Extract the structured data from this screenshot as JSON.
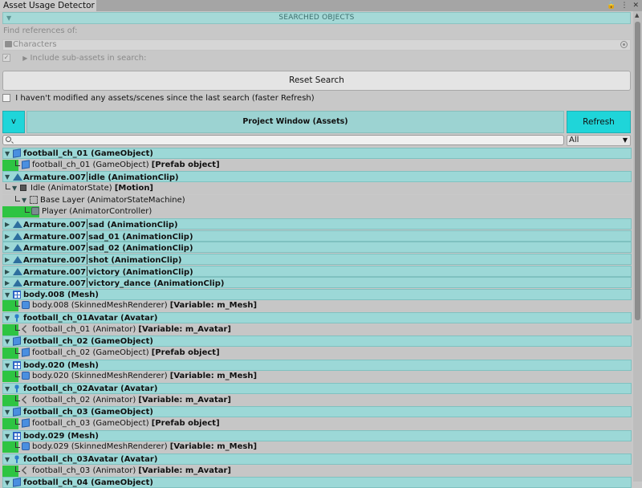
{
  "tab": {
    "title": "Asset Usage Detector"
  },
  "section": {
    "title": "SEARCHED OBJECTS"
  },
  "find": {
    "label": "Find references of:",
    "value": "Characters",
    "include_sub_assets_label": "Include sub-assets in search:"
  },
  "buttons": {
    "reset": "Reset Search",
    "refresh": "Refresh",
    "toggle": "v"
  },
  "faster_refresh_label": "I haven't modified any assets/scenes since the last search (faster Refresh)",
  "results": {
    "title": "Project Window (Assets)",
    "filter": "All",
    "search_placeholder": ""
  },
  "rows": [
    {
      "type": "top",
      "disclosure": "open",
      "icon": "gameobject-icon",
      "text": "football_ch_01 (GameObject)"
    },
    {
      "type": "child",
      "level": 1,
      "icon": "gameobject-icon",
      "text": "football_ch_01 (GameObject) ",
      "tag": "[Prefab object]",
      "bar": 20
    },
    {
      "type": "top",
      "disclosure": "open",
      "icon": "animation-clip-icon",
      "prefix": "Armature.007",
      "text": "idle (AnimationClip)"
    },
    {
      "type": "child",
      "level": 0,
      "disclosure": "open",
      "icon": "animator-state-icon",
      "text": "Idle (AnimatorState) ",
      "tag": "[Motion]",
      "bar": 0
    },
    {
      "type": "child",
      "level": 1,
      "disclosure": "open",
      "icon": "state-machine-icon",
      "text": "Base Layer (AnimatorStateMachine)",
      "tag": "",
      "bar": 0
    },
    {
      "type": "child",
      "level": 2,
      "icon": "animator-controller-icon",
      "text": "Player (AnimatorController)",
      "tag": "",
      "bar": 46
    },
    {
      "type": "top",
      "disclosure": "closed",
      "icon": "animation-clip-icon",
      "prefix": "Armature.007",
      "text": "sad (AnimationClip)"
    },
    {
      "type": "top",
      "disclosure": "closed",
      "icon": "animation-clip-icon",
      "prefix": "Armature.007",
      "text": "sad_01 (AnimationClip)"
    },
    {
      "type": "top",
      "disclosure": "closed",
      "icon": "animation-clip-icon",
      "prefix": "Armature.007",
      "text": "sad_02 (AnimationClip)"
    },
    {
      "type": "top",
      "disclosure": "closed",
      "icon": "animation-clip-icon",
      "prefix": "Armature.007",
      "text": "shot (AnimationClip)"
    },
    {
      "type": "top",
      "disclosure": "closed",
      "icon": "animation-clip-icon",
      "prefix": "Armature.007",
      "text": "victory (AnimationClip)"
    },
    {
      "type": "top",
      "disclosure": "closed",
      "icon": "animation-clip-icon",
      "prefix": "Armature.007",
      "text": "victory_dance (AnimationClip)"
    },
    {
      "type": "top",
      "disclosure": "open",
      "icon": "mesh-icon",
      "text": "body.008 (Mesh)"
    },
    {
      "type": "child",
      "level": 1,
      "icon": "skinned-mesh-renderer-icon",
      "text": "body.008 (SkinnedMeshRenderer) ",
      "tag": "[Variable: m_Mesh]",
      "bar": 20
    },
    {
      "type": "top",
      "disclosure": "open",
      "icon": "avatar-icon",
      "text": "football_ch_01Avatar (Avatar)"
    },
    {
      "type": "child",
      "level": 1,
      "icon": "animator-icon",
      "text": "football_ch_01 (Animator) ",
      "tag": "[Variable: m_Avatar]",
      "bar": 20
    },
    {
      "type": "top",
      "disclosure": "open",
      "icon": "gameobject-icon",
      "text": "football_ch_02 (GameObject)"
    },
    {
      "type": "child",
      "level": 1,
      "icon": "gameobject-icon",
      "text": "football_ch_02 (GameObject) ",
      "tag": "[Prefab object]",
      "bar": 20
    },
    {
      "type": "top",
      "disclosure": "open",
      "icon": "mesh-icon",
      "text": "body.020 (Mesh)"
    },
    {
      "type": "child",
      "level": 1,
      "icon": "skinned-mesh-renderer-icon",
      "text": "body.020 (SkinnedMeshRenderer) ",
      "tag": "[Variable: m_Mesh]",
      "bar": 20
    },
    {
      "type": "top",
      "disclosure": "open",
      "icon": "avatar-icon",
      "text": "football_ch_02Avatar (Avatar)"
    },
    {
      "type": "child",
      "level": 1,
      "icon": "animator-icon",
      "text": "football_ch_02 (Animator) ",
      "tag": "[Variable: m_Avatar]",
      "bar": 20
    },
    {
      "type": "top",
      "disclosure": "open",
      "icon": "gameobject-icon",
      "text": "football_ch_03 (GameObject)"
    },
    {
      "type": "child",
      "level": 1,
      "icon": "gameobject-icon",
      "text": "football_ch_03 (GameObject) ",
      "tag": "[Prefab object]",
      "bar": 20
    },
    {
      "type": "top",
      "disclosure": "open",
      "icon": "mesh-icon",
      "text": "body.029 (Mesh)"
    },
    {
      "type": "child",
      "level": 1,
      "icon": "skinned-mesh-renderer-icon",
      "text": "body.029 (SkinnedMeshRenderer) ",
      "tag": "[Variable: m_Mesh]",
      "bar": 20
    },
    {
      "type": "top",
      "disclosure": "open",
      "icon": "avatar-icon",
      "text": "football_ch_03Avatar (Avatar)"
    },
    {
      "type": "child",
      "level": 1,
      "icon": "animator-icon",
      "text": "football_ch_03 (Animator) ",
      "tag": "[Variable: m_Avatar]",
      "bar": 20
    },
    {
      "type": "top",
      "disclosure": "open",
      "icon": "gameobject-icon",
      "text": "football_ch_04 (GameObject)"
    }
  ]
}
